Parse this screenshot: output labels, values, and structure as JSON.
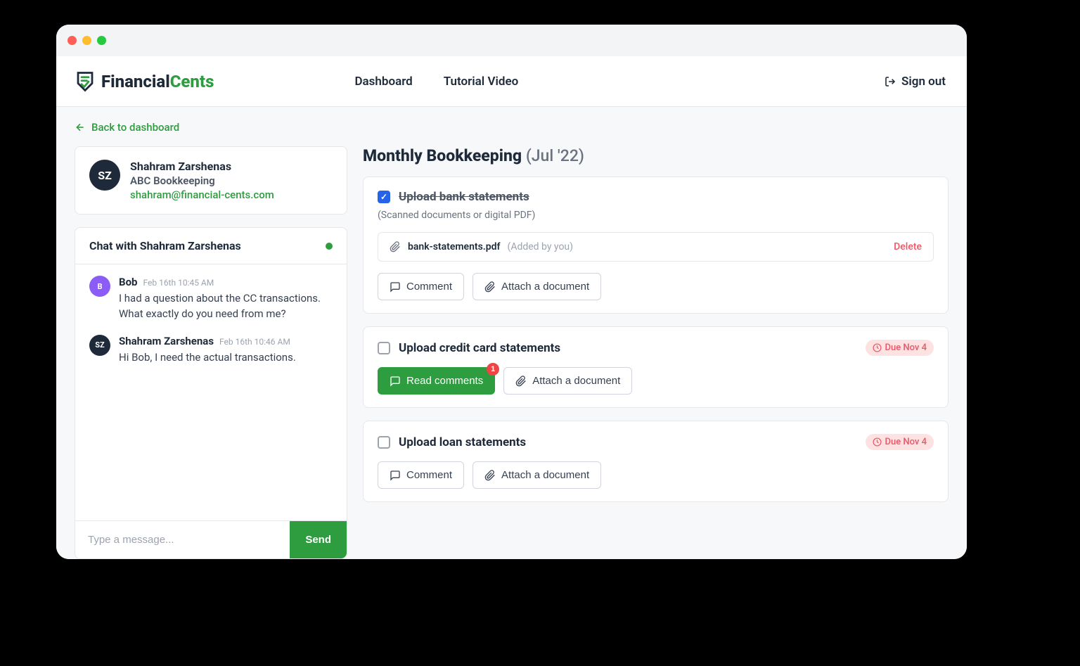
{
  "brand": {
    "name1": "Financial",
    "name2": "Cents"
  },
  "nav": {
    "dashboard": "Dashboard",
    "tutorial": "Tutorial Video",
    "signout": "Sign out"
  },
  "back_link": "Back to dashboard",
  "contact": {
    "initials": "SZ",
    "name": "Shahram Zarshenas",
    "company": "ABC Bookkeeping",
    "email": "shahram@financial-cents.com"
  },
  "chat": {
    "title": "Chat with Shahram Zarshenas",
    "messages": [
      {
        "avatar_text": "B",
        "avatar_class": "avatar-purple",
        "name": "Bob",
        "time": "Feb 16th 10:45 AM",
        "text": "I had a question about the CC transactions. What exactly do you need from me?"
      },
      {
        "avatar_text": "SZ",
        "avatar_class": "avatar-dark",
        "name": "Shahram Zarshenas",
        "time": "Feb 16th 10:46 AM",
        "text": "Hi Bob, I need the actual transactions."
      }
    ],
    "input_placeholder": "Type a message...",
    "send_label": "Send"
  },
  "page": {
    "title": "Monthly Bookkeeping",
    "period": "(Jul '22)"
  },
  "tasks": [
    {
      "checked": true,
      "title": "Upload bank statements",
      "subtitle": "(Scanned documents or digital PDF)",
      "file": {
        "name": "bank-statements.pdf",
        "added": "(Added by you)",
        "delete": "Delete"
      },
      "comment_label": "Comment",
      "attach_label": "Attach a document"
    },
    {
      "checked": false,
      "title": "Upload credit card statements",
      "due": "Due Nov 4",
      "read_comments_label": "Read comments",
      "read_comments_count": "1",
      "attach_label": "Attach a document"
    },
    {
      "checked": false,
      "title": "Upload loan statements",
      "due": "Due Nov 4",
      "comment_label": "Comment",
      "attach_label": "Attach a document"
    }
  ]
}
